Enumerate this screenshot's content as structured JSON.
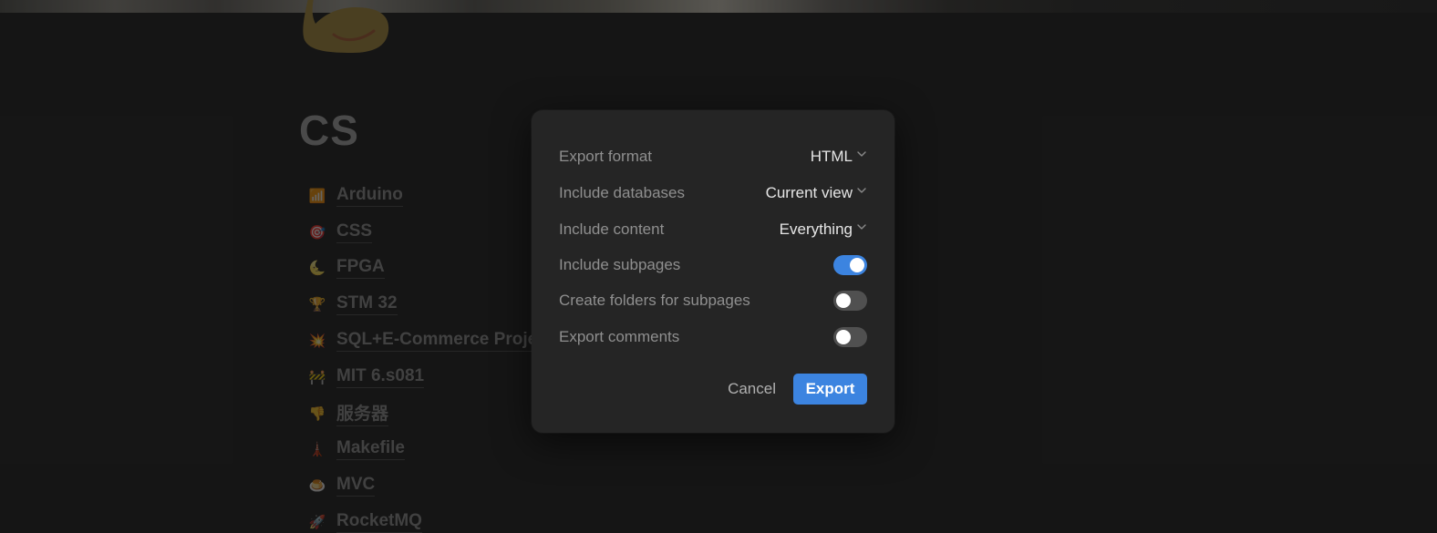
{
  "page": {
    "title": "CS",
    "items": [
      {
        "emoji": "📶",
        "label": "Arduino"
      },
      {
        "emoji": "🎯",
        "label": "CSS"
      },
      {
        "emoji": "🌜",
        "label": "FPGA"
      },
      {
        "emoji": "🏆",
        "label": "STM 32"
      },
      {
        "emoji": "💥",
        "label": "SQL+E-Commerce Proje"
      },
      {
        "emoji": "🚧",
        "label": "MIT 6.s081"
      },
      {
        "emoji": "👎",
        "label": "服务器"
      },
      {
        "emoji": "🗼",
        "label": "Makefile"
      },
      {
        "emoji": "🍮",
        "label": "MVC"
      },
      {
        "emoji": "🚀",
        "label": "RocketMQ"
      }
    ]
  },
  "export_dialog": {
    "format_label": "Export format",
    "format_value": "HTML",
    "databases_label": "Include databases",
    "databases_value": "Current view",
    "content_label": "Include content",
    "content_value": "Everything",
    "subpages_label": "Include subpages",
    "subpages_on": true,
    "folders_label": "Create folders for subpages",
    "folders_on": false,
    "comments_label": "Export comments",
    "comments_on": false,
    "cancel_label": "Cancel",
    "export_label": "Export"
  },
  "colors": {
    "background": "#191919",
    "dialog": "#252525",
    "accent": "#3c84e0",
    "toggle_off": "#505050"
  }
}
